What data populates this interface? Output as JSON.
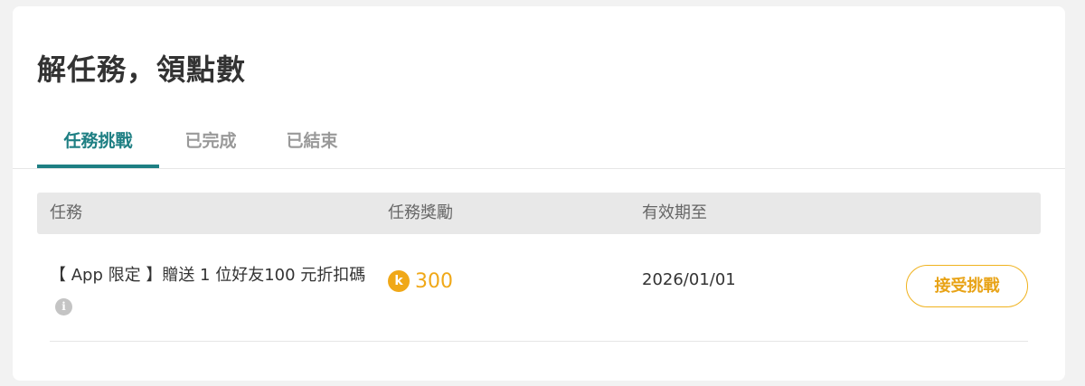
{
  "page": {
    "title": "解任務，領點數"
  },
  "tabs": [
    {
      "label": "任務挑戰",
      "active": true
    },
    {
      "label": "已完成",
      "active": false
    },
    {
      "label": "已結束",
      "active": false
    }
  ],
  "table": {
    "headers": {
      "task": "任務",
      "reward": "任務獎勵",
      "expiry": "有效期至"
    },
    "rows": [
      {
        "task": "【 App 限定 】贈送 1 位好友100 元折扣碼",
        "info_icon": "info-icon",
        "info_glyph": "i",
        "coin_icon": "coin-icon",
        "coin_glyph": "k",
        "reward": "300",
        "expiry": "2026/01/01",
        "action_label": "接受挑戰"
      }
    ]
  },
  "colors": {
    "accent": "#1e7f83",
    "coin": "#f0a818",
    "button_border": "#f0b21e",
    "page_bg": "#f2f2f2",
    "header_bg": "#e8e8e8"
  }
}
